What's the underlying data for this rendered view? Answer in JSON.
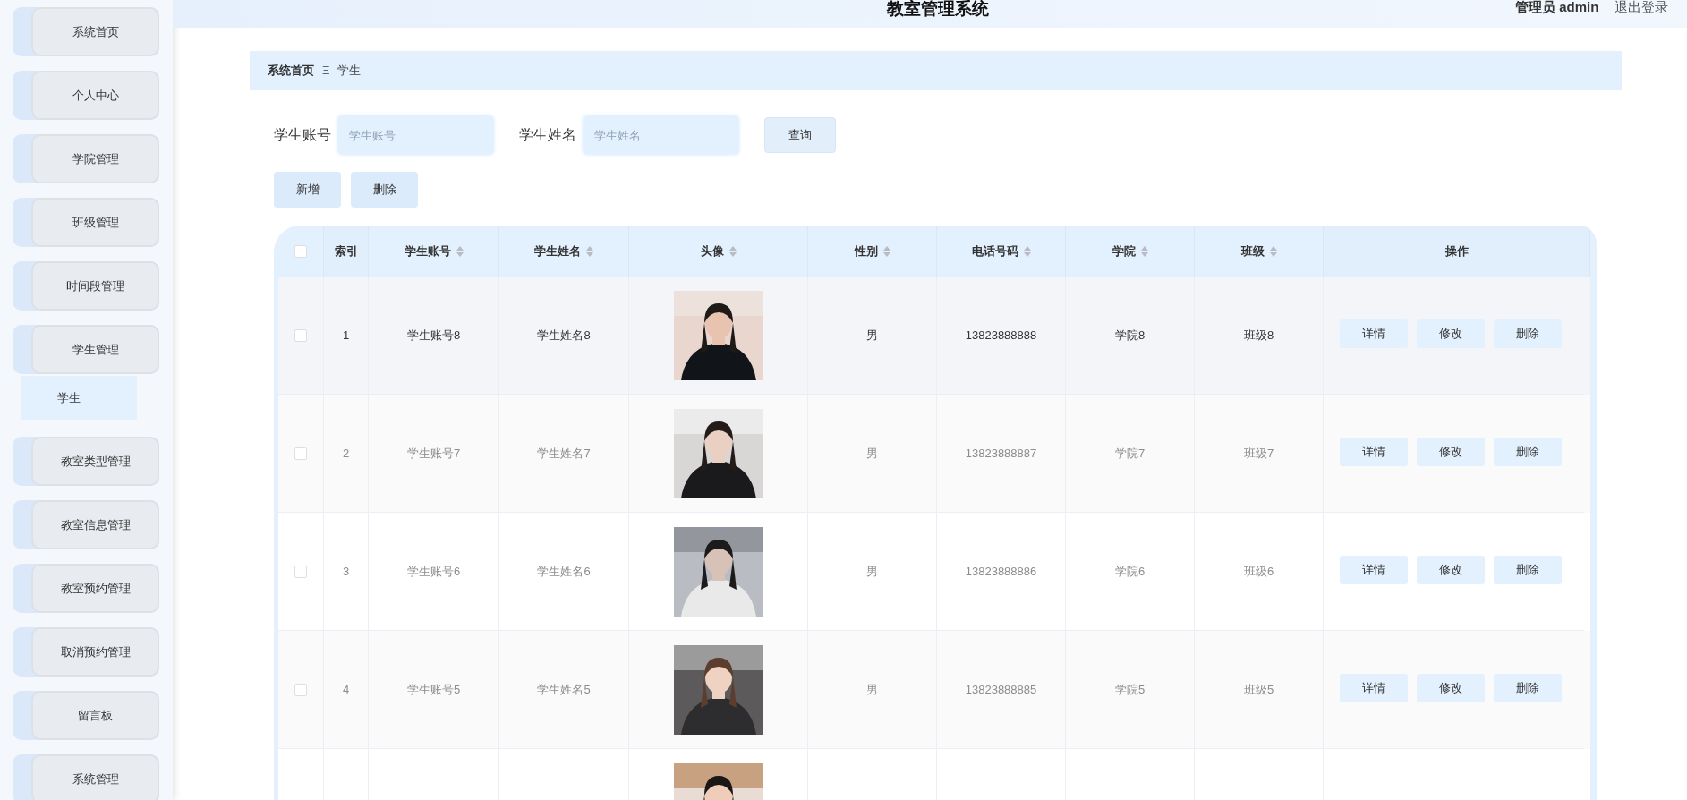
{
  "header": {
    "title": "教室管理系统",
    "user": "管理员 admin",
    "logout": "退出登录"
  },
  "sidebar": {
    "items": [
      {
        "label": "系统首页"
      },
      {
        "label": "个人中心"
      },
      {
        "label": "学院管理"
      },
      {
        "label": "班级管理"
      },
      {
        "label": "时间段管理"
      },
      {
        "label": "学生管理",
        "children": [
          {
            "label": "学生",
            "selected": true
          }
        ]
      },
      {
        "label": "教室类型管理"
      },
      {
        "label": "教室信息管理"
      },
      {
        "label": "教室预约管理"
      },
      {
        "label": "取消预约管理"
      },
      {
        "label": "留言板"
      },
      {
        "label": "系统管理"
      }
    ]
  },
  "breadcrumb": {
    "items": [
      "系统首页",
      "学生"
    ],
    "separator": "Ξ"
  },
  "search": {
    "fields": [
      {
        "label": "学生账号",
        "placeholder": "学生账号"
      },
      {
        "label": "学生姓名",
        "placeholder": "学生姓名"
      }
    ],
    "button": "查询"
  },
  "actions": [
    "新增",
    "删除"
  ],
  "table": {
    "all_checked": false,
    "columns": [
      {
        "label": "索引",
        "sortable": false
      },
      {
        "label": "学生账号",
        "sortable": true
      },
      {
        "label": "学生姓名",
        "sortable": true
      },
      {
        "label": "头像",
        "sortable": true
      },
      {
        "label": "性别",
        "sortable": true
      },
      {
        "label": "电话号码",
        "sortable": true
      },
      {
        "label": "学院",
        "sortable": true
      },
      {
        "label": "班级",
        "sortable": true
      },
      {
        "label": "操作",
        "sortable": false
      }
    ],
    "rows": [
      {
        "hovered": true,
        "checked": false,
        "cells": [
          {
            "kind": "text",
            "text": "1"
          },
          {
            "kind": "text",
            "text": "学生账号8"
          },
          {
            "kind": "text",
            "text": "学生姓名8"
          },
          {
            "kind": "picture"
          },
          {
            "kind": "text",
            "text": "男"
          },
          {
            "kind": "text",
            "text": "13823888888"
          },
          {
            "kind": "text",
            "text": "学院8"
          },
          {
            "kind": "text",
            "text": "班级8"
          },
          {
            "kind": "actions",
            "buttons": [
              "详情",
              "修改",
              "删除"
            ]
          }
        ]
      },
      {
        "hovered": false,
        "checked": false,
        "cells": [
          {
            "kind": "text",
            "text": "2"
          },
          {
            "kind": "text",
            "text": "学生账号7"
          },
          {
            "kind": "text",
            "text": "学生姓名7"
          },
          {
            "kind": "picture"
          },
          {
            "kind": "text",
            "text": "男"
          },
          {
            "kind": "text",
            "text": "13823888887"
          },
          {
            "kind": "text",
            "text": "学院7"
          },
          {
            "kind": "text",
            "text": "班级7"
          },
          {
            "kind": "actions",
            "buttons": [
              "详情",
              "修改",
              "删除"
            ]
          }
        ]
      },
      {
        "hovered": false,
        "checked": false,
        "cells": [
          {
            "kind": "text",
            "text": "3"
          },
          {
            "kind": "text",
            "text": "学生账号6"
          },
          {
            "kind": "text",
            "text": "学生姓名6"
          },
          {
            "kind": "picture"
          },
          {
            "kind": "text",
            "text": "男"
          },
          {
            "kind": "text",
            "text": "13823888886"
          },
          {
            "kind": "text",
            "text": "学院6"
          },
          {
            "kind": "text",
            "text": "班级6"
          },
          {
            "kind": "actions",
            "buttons": [
              "详情",
              "修改",
              "删除"
            ]
          }
        ]
      },
      {
        "hovered": false,
        "checked": false,
        "cells": [
          {
            "kind": "text",
            "text": "4"
          },
          {
            "kind": "text",
            "text": "学生账号5"
          },
          {
            "kind": "text",
            "text": "学生姓名5"
          },
          {
            "kind": "picture"
          },
          {
            "kind": "text",
            "text": "男"
          },
          {
            "kind": "text",
            "text": "13823888885"
          },
          {
            "kind": "text",
            "text": "学院5"
          },
          {
            "kind": "text",
            "text": "班级5"
          },
          {
            "kind": "actions",
            "buttons": [
              "详情",
              "修改",
              "删除"
            ]
          }
        ]
      }
    ],
    "partial_row": {
      "avatar": {
        "kind": "picture"
      }
    }
  }
}
